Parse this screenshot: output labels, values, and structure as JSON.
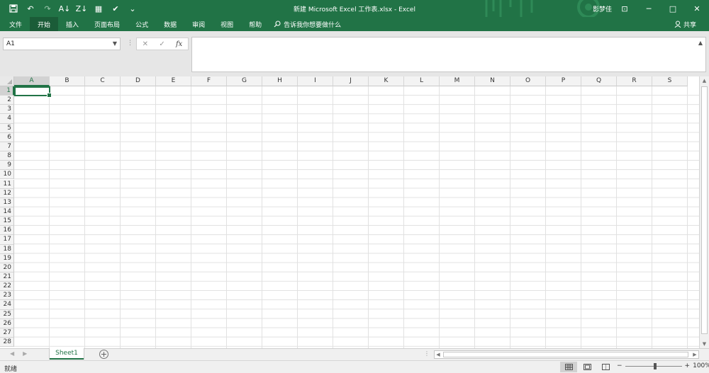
{
  "titlebar": {
    "title": "新建 Microsoft Excel 工作表.xlsx  -  Excel",
    "user": "影梦佳",
    "qat": {
      "save": "💾",
      "undo": "↶",
      "redo": "↷",
      "sort_asc": "A↓",
      "sort_desc": "Z↓",
      "form": "▦",
      "paint": "✔",
      "customize": "⌄"
    },
    "window": {
      "ribbon": "⊡",
      "minimize": "─",
      "maximize": "□",
      "close": "✕"
    }
  },
  "ribbon": {
    "tabs": [
      "文件",
      "开始",
      "插入",
      "页面布局",
      "公式",
      "数据",
      "审阅",
      "视图",
      "帮助"
    ],
    "active_tab": "开始",
    "tell_me": "告诉我你想要做什么",
    "share": "共享"
  },
  "formula_bar": {
    "name_box": "A1",
    "cancel": "✕",
    "enter": "✓",
    "fx": "fx",
    "formula": ""
  },
  "grid": {
    "columns": [
      "A",
      "B",
      "C",
      "D",
      "E",
      "F",
      "G",
      "H",
      "I",
      "J",
      "K",
      "L",
      "M",
      "N",
      "O",
      "P",
      "Q",
      "R",
      "S"
    ],
    "rows": [
      "1",
      "2",
      "3",
      "4",
      "5",
      "6",
      "7",
      "8",
      "9",
      "10",
      "11",
      "12",
      "13",
      "14",
      "15",
      "16",
      "17",
      "18",
      "19",
      "20",
      "21",
      "22",
      "23",
      "24",
      "25",
      "26",
      "27",
      "28"
    ],
    "selected_cell": "A1"
  },
  "sheets": {
    "tabs": [
      "Sheet1"
    ],
    "active": "Sheet1",
    "add": "+"
  },
  "statusbar": {
    "status": "就绪",
    "zoom": "100%",
    "zoom_minus": "−",
    "zoom_plus": "+"
  },
  "colors": {
    "accent": "#217346",
    "tab_active": "#1b5c38",
    "header_bg": "#f3f3f3",
    "gridline": "#e1e1e1"
  }
}
